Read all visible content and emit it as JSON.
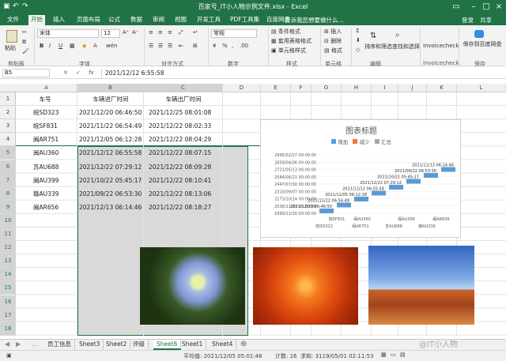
{
  "window": {
    "title": "百家号_IT小人物示例文件.xlsx - Excel",
    "search_placeholder": "告诉我您想要做什么...",
    "user_login": "登录",
    "share": "共享"
  },
  "ribbon_tabs": [
    "文件",
    "开始",
    "插入",
    "页面布局",
    "公式",
    "数据",
    "审阅",
    "视图",
    "开发工具",
    "PDF工具集",
    "百度网盘"
  ],
  "active_ribbon_tab": "开始",
  "ribbon": {
    "paste": "粘贴",
    "font_name": "宋体",
    "font_size": "12",
    "number_format": "常规",
    "cond_format": "条件格式",
    "table_format": "套用表格格式",
    "cell_style": "单元格样式",
    "insert": "插入",
    "delete": "删除",
    "format": "格式",
    "sort_filter": "排序和筛选",
    "find_select": "查找和选择",
    "invoicecheck1": "invoicecheck",
    "invoicecheck2": "invoicecheck",
    "save_baidu": "保存到百度网盘",
    "groups": [
      "剪贴板",
      "字体",
      "对齐方式",
      "数字",
      "样式",
      "单元格",
      "编辑",
      "",
      "保存"
    ],
    "bold": "B",
    "italic": "I",
    "underline": "U"
  },
  "formula_bar": {
    "name_box": "B5",
    "fx": "fx",
    "value": "2021/12/12  6:55:58"
  },
  "columns": [
    "A",
    "B",
    "C",
    "D",
    "E",
    "F",
    "G",
    "H",
    "I",
    "J",
    "K",
    "L"
  ],
  "rows": [
    "1",
    "2",
    "3",
    "4",
    "5",
    "6",
    "7",
    "8",
    "9",
    "10",
    "11",
    "12",
    "13",
    "14",
    "15",
    "16",
    "17",
    "18"
  ],
  "table": {
    "headers": [
      "车号",
      "车辆进厂时间",
      "车辆出厂时间"
    ],
    "data": [
      [
        "皖SD323",
        "2021/12/20 06:46:50",
        "2021/12/25 08:01:08"
      ],
      [
        "皖SF831",
        "2021/11/22 06:54:49",
        "2021/12/22 08:02:33"
      ],
      [
        "闽AR751",
        "2021/12/05 06:12:28",
        "2021/12/22 08:04:29"
      ],
      [
        "闽AU360",
        "2021/12/12 06:55:58",
        "2021/12/22 08:07:15"
      ],
      [
        "苏AU688",
        "2021/12/22 07:29:12",
        "2021/12/22 08:09:28"
      ],
      [
        "闽AU399",
        "2021/10/22 05:45:17",
        "2021/12/22 08:10:41"
      ],
      [
        "赣AU339",
        "2021/09/22 06:53:30",
        "2021/12/22 08:13:06"
      ],
      [
        "闽AR656",
        "2021/12/13 06:14:46",
        "2021/12/22 08:18:27"
      ]
    ]
  },
  "chart_data": {
    "type": "bar",
    "title": "图表标题",
    "legend": [
      "增加",
      "减少",
      "汇总"
    ],
    "legend_colors": [
      "#5b9bd5",
      "#ed7d31",
      "#a5a5a5"
    ],
    "legend_position": "top",
    "y_ticks": [
      "2995/02/27 00:00:00",
      "2858/04/06 00:00:00",
      "2721/05/13 00:00:00",
      "2584/06/21 00:00:00",
      "2447/07/30 00:00:00",
      "2310/09/07 00:00:00",
      "2173/10/14 00:00:00",
      "2036/11/21 00:00:00",
      "1899/12/30 00:00:00"
    ],
    "categories": [
      "皖SD323",
      "皖SF831",
      "闽AR751",
      "闽AU360",
      "苏AU688",
      "闽AU399",
      "赣AU339",
      "闽AR656"
    ],
    "x_labels_row1": [
      "皖SF831",
      "闽AU360",
      "闽AU399",
      "闽AR656"
    ],
    "x_labels_row2": [
      "皖SD323",
      "闽AR751",
      "苏AU688",
      "赣AU339"
    ],
    "data_labels": [
      "2021/12/20 06:46:50",
      "2021/11/22 06:54:49",
      "2021/12/05 06:12:28",
      "2021/12/12 06:55:58",
      "2021/12/22 07:29:12",
      "2021/10/22 05:45:17",
      "2021/09/22 06:53:30",
      "2021/12/13 06:14:46"
    ],
    "bar_color": "#5b9bd5"
  },
  "images": [
    {
      "name": "hydrangea",
      "colors": [
        "#2b4a1c",
        "#8fa7d8",
        "#e8f0a8"
      ]
    },
    {
      "name": "orange-flower",
      "colors": [
        "#c8360a",
        "#f06a1c",
        "#ffab40"
      ]
    },
    {
      "name": "desert",
      "colors": [
        "#3a6fc7",
        "#9ec1f0",
        "#a5431e",
        "#d27a3a"
      ]
    }
  ],
  "sheet_tabs": [
    "员工信息",
    "Sheet3",
    "Sheet2",
    "评级",
    "Sheet6",
    "Sheet1",
    "Sheet4"
  ],
  "active_sheet": "Sheet6",
  "status": {
    "average": "平均值: 2021/12/05 05:01:46",
    "count": "计数: 16",
    "sum": "求和: 3119/05/01 02:11:53"
  },
  "watermark": "@IT小人物"
}
